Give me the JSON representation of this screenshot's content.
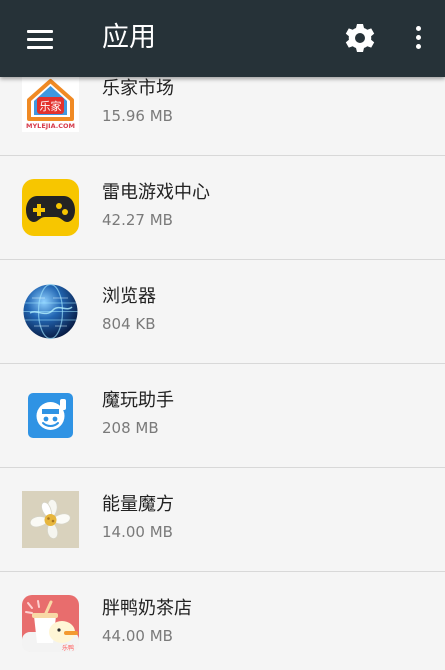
{
  "toolbar": {
    "title": "应用",
    "menu_icon": "hamburger-menu-icon",
    "settings_icon": "gear-icon",
    "overflow_icon": "more-vert-icon",
    "background_color": "#263238"
  },
  "apps": [
    {
      "name": "乐家市场",
      "size": "15.96 MB",
      "icon": "lejia-market-icon",
      "icon_text": "乐家",
      "icon_caption": "MYLEJIA.COM"
    },
    {
      "name": "雷电游戏中心",
      "size": "42.27 MB",
      "icon": "gamepad-icon"
    },
    {
      "name": "浏览器",
      "size": "804 KB",
      "icon": "globe-icon"
    },
    {
      "name": "魔玩助手",
      "size": "208 MB",
      "icon": "mowan-assistant-icon"
    },
    {
      "name": "能量魔方",
      "size": "14.00 MB",
      "icon": "white-flower-icon"
    },
    {
      "name": "胖鸭奶茶店",
      "size": "44.00 MB",
      "icon": "duck-milk-tea-icon",
      "icon_text": "乐鸭"
    }
  ]
}
